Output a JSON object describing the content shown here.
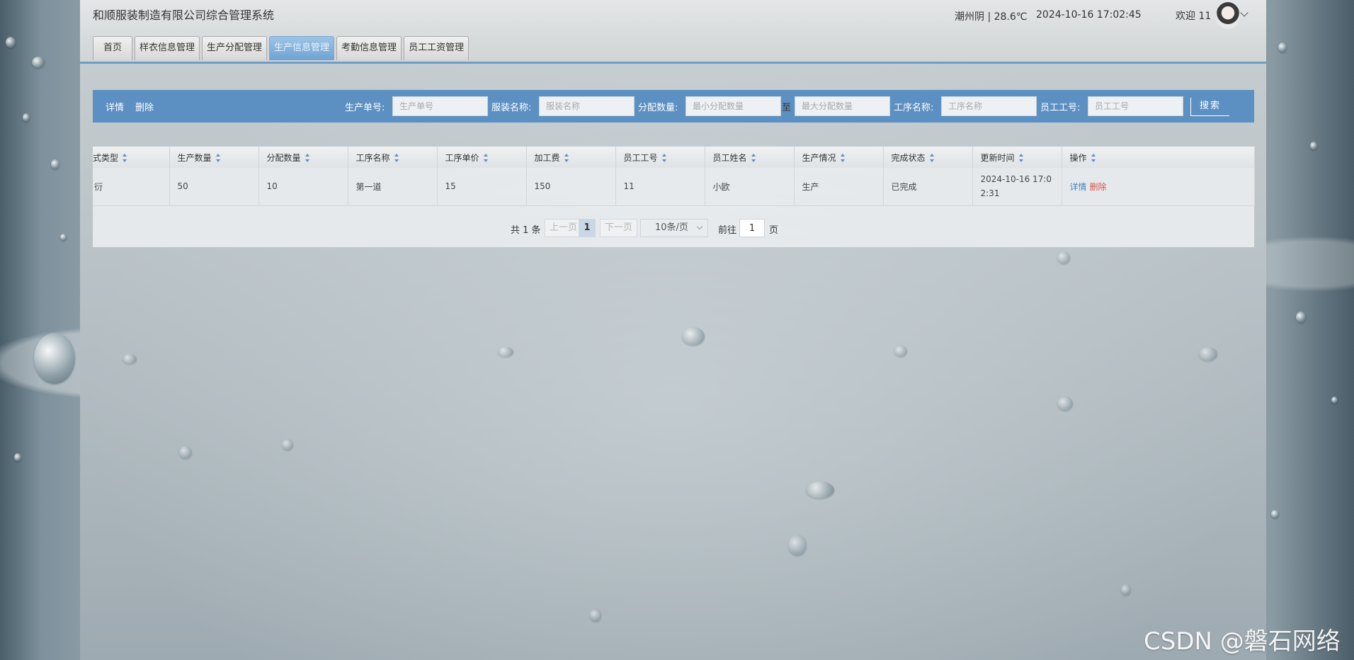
{
  "header": {
    "system_title": "和顺服装制造有限公司综合管理系统",
    "weather": "潮州阴 | 28.6℃",
    "datetime": "2024-10-16  17:02:45",
    "welcome": "欢迎 11"
  },
  "nav": {
    "tabs": [
      {
        "label": "首页",
        "active": false
      },
      {
        "label": "样衣信息管理",
        "active": false
      },
      {
        "label": "生产分配管理",
        "active": false
      },
      {
        "label": "生产信息管理",
        "active": true
      },
      {
        "label": "考勤信息管理",
        "active": false
      },
      {
        "label": "员工工资管理",
        "active": false
      }
    ]
  },
  "search": {
    "detail_label": "详情",
    "delete_label": "删除",
    "order_no_label": "生产单号:",
    "order_no_placeholder": "生产单号",
    "garment_label": "服装名称:",
    "garment_placeholder": "服装名称",
    "qty_label": "分配数量:",
    "qty_min_placeholder": "最小分配数量",
    "qty_to": "至",
    "qty_max_placeholder": "最大分配数量",
    "process_label": "工序名称:",
    "process_placeholder": "工序名称",
    "emp_no_label": "员工工号:",
    "emp_no_placeholder": "员工工号",
    "search_button": "搜索"
  },
  "table": {
    "columns": [
      "式类型",
      "生产数量",
      "分配数量",
      "工序名称",
      "工序单价",
      "加工费",
      "员工工号",
      "员工姓名",
      "生产情况",
      "完成状态",
      "更新时间",
      "操作"
    ],
    "rows": [
      {
        "type": "衍",
        "production_qty": "50",
        "assigned_qty": "10",
        "process_name": "第一道",
        "unit_price": "15",
        "fee": "150",
        "emp_no": "11",
        "emp_name": "小欧",
        "production_status": "生产",
        "complete_status": "已完成",
        "updated_at": "2024-10-16 17:02:31",
        "op_detail": "详情",
        "op_delete": "删除"
      }
    ]
  },
  "pagination": {
    "total": "共 1 条",
    "prev": "上一页",
    "current": "1",
    "next": "下一页",
    "page_size": "10条/页",
    "goto_label": "前往",
    "goto_value": "1",
    "page_suffix": "页"
  },
  "watermark": "CSDN @磐石网络"
}
